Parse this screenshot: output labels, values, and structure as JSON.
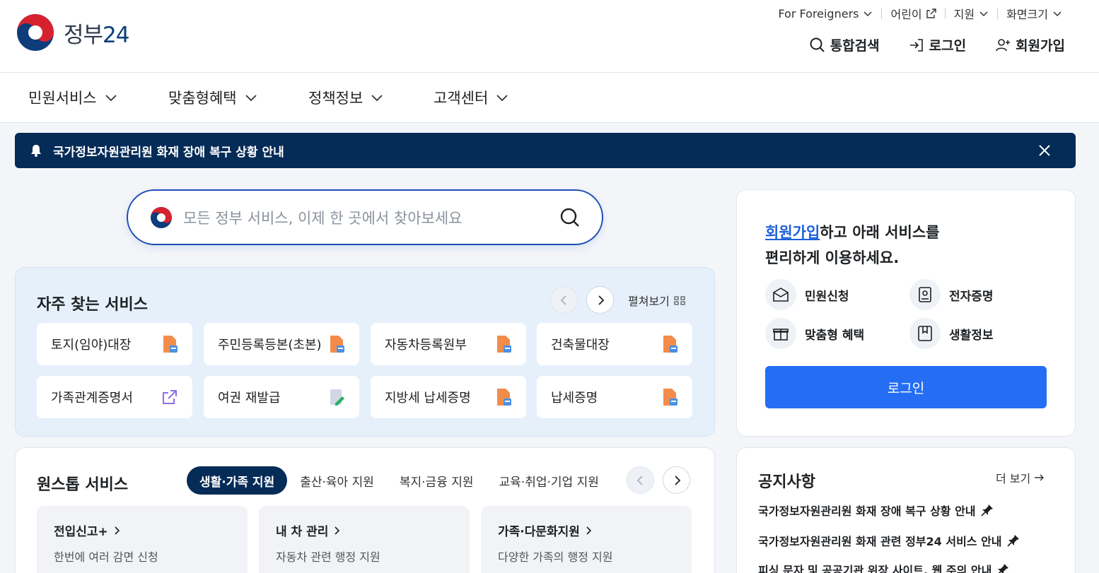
{
  "header": {
    "logo_text_ko": "정부",
    "logo_text_num": "24",
    "util": {
      "foreigners": "For Foreigners",
      "kids": "어린이",
      "support": "지원",
      "zoom": "화면크기"
    },
    "actions": {
      "search": "통합검색",
      "login": "로그인",
      "signup": "회원가입"
    }
  },
  "gnb": [
    "민원서비스",
    "맞춤형혜택",
    "정책정보",
    "고객센터"
  ],
  "alert": {
    "text": "국가정보자원관리원 화재 장애 복구 상황 안내"
  },
  "search": {
    "placeholder": "모든 정부 서비스, 이제 한 곳에서 찾아보세요"
  },
  "frequent": {
    "title": "자주 찾는 서비스",
    "expand": "펼쳐보기",
    "items": [
      {
        "label": "토지(임야)대장",
        "icon": "pdf-icon"
      },
      {
        "label": "주민등록등본(초본)",
        "icon": "pdf-icon"
      },
      {
        "label": "자동차등록원부",
        "icon": "pdf-icon"
      },
      {
        "label": "건축물대장",
        "icon": "pdf-icon"
      },
      {
        "label": "가족관계증명서",
        "icon": "external-link-icon"
      },
      {
        "label": "여권 재발급",
        "icon": "edit-doc-icon"
      },
      {
        "label": "지방세 납세증명",
        "icon": "pdf-icon"
      },
      {
        "label": "납세증명",
        "icon": "pdf-icon"
      }
    ]
  },
  "onestop": {
    "title": "원스톱 서비스",
    "tabs": [
      "생활·가족 지원",
      "출산·육아 지원",
      "복지·금융 지원",
      "교육·취업·기업 지원"
    ],
    "active_tab": 0,
    "cards": [
      {
        "title": "전입신고+",
        "desc": "한번에 여러 감면 신청"
      },
      {
        "title": "내 차 관리",
        "desc": "자동차 관련 행정 지원"
      },
      {
        "title": "가족·다문화지원",
        "desc": "다양한 가족의 행정 지원"
      }
    ]
  },
  "login_panel": {
    "msg_link": "회원가입",
    "msg_rest1": "하고 아래 서비스를",
    "msg_line2": "편리하게 이용하세요.",
    "services": [
      "민원신청",
      "전자증명",
      "맞춤형 혜택",
      "생활정보"
    ],
    "button": "로그인"
  },
  "notices": {
    "title": "공지사항",
    "more": "더 보기",
    "items": [
      "국가정보자원관리원 화재 장애 복구 상황 안내",
      "국가정보자원관리원 화재 관련 정부24 서비스 안내",
      "피싱 문자 및 공공기관 위장 사이트, 웹 주의 안내"
    ]
  },
  "colors": {
    "navy": "#052b57",
    "primary_blue": "#256ef4",
    "link_blue": "#1e5fd8"
  }
}
